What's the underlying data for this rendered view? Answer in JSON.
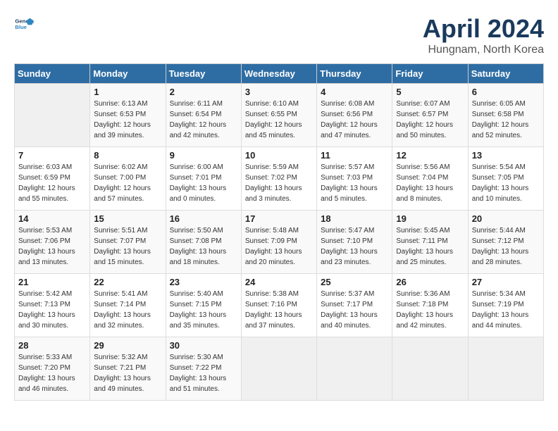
{
  "logo": {
    "text_general": "General",
    "text_blue": "Blue"
  },
  "title": "April 2024",
  "location": "Hungnam, North Korea",
  "days_header": [
    "Sunday",
    "Monday",
    "Tuesday",
    "Wednesday",
    "Thursday",
    "Friday",
    "Saturday"
  ],
  "weeks": [
    [
      {
        "num": "",
        "info": ""
      },
      {
        "num": "1",
        "info": "Sunrise: 6:13 AM\nSunset: 6:53 PM\nDaylight: 12 hours\nand 39 minutes."
      },
      {
        "num": "2",
        "info": "Sunrise: 6:11 AM\nSunset: 6:54 PM\nDaylight: 12 hours\nand 42 minutes."
      },
      {
        "num": "3",
        "info": "Sunrise: 6:10 AM\nSunset: 6:55 PM\nDaylight: 12 hours\nand 45 minutes."
      },
      {
        "num": "4",
        "info": "Sunrise: 6:08 AM\nSunset: 6:56 PM\nDaylight: 12 hours\nand 47 minutes."
      },
      {
        "num": "5",
        "info": "Sunrise: 6:07 AM\nSunset: 6:57 PM\nDaylight: 12 hours\nand 50 minutes."
      },
      {
        "num": "6",
        "info": "Sunrise: 6:05 AM\nSunset: 6:58 PM\nDaylight: 12 hours\nand 52 minutes."
      }
    ],
    [
      {
        "num": "7",
        "info": "Sunrise: 6:03 AM\nSunset: 6:59 PM\nDaylight: 12 hours\nand 55 minutes."
      },
      {
        "num": "8",
        "info": "Sunrise: 6:02 AM\nSunset: 7:00 PM\nDaylight: 12 hours\nand 57 minutes."
      },
      {
        "num": "9",
        "info": "Sunrise: 6:00 AM\nSunset: 7:01 PM\nDaylight: 13 hours\nand 0 minutes."
      },
      {
        "num": "10",
        "info": "Sunrise: 5:59 AM\nSunset: 7:02 PM\nDaylight: 13 hours\nand 3 minutes."
      },
      {
        "num": "11",
        "info": "Sunrise: 5:57 AM\nSunset: 7:03 PM\nDaylight: 13 hours\nand 5 minutes."
      },
      {
        "num": "12",
        "info": "Sunrise: 5:56 AM\nSunset: 7:04 PM\nDaylight: 13 hours\nand 8 minutes."
      },
      {
        "num": "13",
        "info": "Sunrise: 5:54 AM\nSunset: 7:05 PM\nDaylight: 13 hours\nand 10 minutes."
      }
    ],
    [
      {
        "num": "14",
        "info": "Sunrise: 5:53 AM\nSunset: 7:06 PM\nDaylight: 13 hours\nand 13 minutes."
      },
      {
        "num": "15",
        "info": "Sunrise: 5:51 AM\nSunset: 7:07 PM\nDaylight: 13 hours\nand 15 minutes."
      },
      {
        "num": "16",
        "info": "Sunrise: 5:50 AM\nSunset: 7:08 PM\nDaylight: 13 hours\nand 18 minutes."
      },
      {
        "num": "17",
        "info": "Sunrise: 5:48 AM\nSunset: 7:09 PM\nDaylight: 13 hours\nand 20 minutes."
      },
      {
        "num": "18",
        "info": "Sunrise: 5:47 AM\nSunset: 7:10 PM\nDaylight: 13 hours\nand 23 minutes."
      },
      {
        "num": "19",
        "info": "Sunrise: 5:45 AM\nSunset: 7:11 PM\nDaylight: 13 hours\nand 25 minutes."
      },
      {
        "num": "20",
        "info": "Sunrise: 5:44 AM\nSunset: 7:12 PM\nDaylight: 13 hours\nand 28 minutes."
      }
    ],
    [
      {
        "num": "21",
        "info": "Sunrise: 5:42 AM\nSunset: 7:13 PM\nDaylight: 13 hours\nand 30 minutes."
      },
      {
        "num": "22",
        "info": "Sunrise: 5:41 AM\nSunset: 7:14 PM\nDaylight: 13 hours\nand 32 minutes."
      },
      {
        "num": "23",
        "info": "Sunrise: 5:40 AM\nSunset: 7:15 PM\nDaylight: 13 hours\nand 35 minutes."
      },
      {
        "num": "24",
        "info": "Sunrise: 5:38 AM\nSunset: 7:16 PM\nDaylight: 13 hours\nand 37 minutes."
      },
      {
        "num": "25",
        "info": "Sunrise: 5:37 AM\nSunset: 7:17 PM\nDaylight: 13 hours\nand 40 minutes."
      },
      {
        "num": "26",
        "info": "Sunrise: 5:36 AM\nSunset: 7:18 PM\nDaylight: 13 hours\nand 42 minutes."
      },
      {
        "num": "27",
        "info": "Sunrise: 5:34 AM\nSunset: 7:19 PM\nDaylight: 13 hours\nand 44 minutes."
      }
    ],
    [
      {
        "num": "28",
        "info": "Sunrise: 5:33 AM\nSunset: 7:20 PM\nDaylight: 13 hours\nand 46 minutes."
      },
      {
        "num": "29",
        "info": "Sunrise: 5:32 AM\nSunset: 7:21 PM\nDaylight: 13 hours\nand 49 minutes."
      },
      {
        "num": "30",
        "info": "Sunrise: 5:30 AM\nSunset: 7:22 PM\nDaylight: 13 hours\nand 51 minutes."
      },
      {
        "num": "",
        "info": ""
      },
      {
        "num": "",
        "info": ""
      },
      {
        "num": "",
        "info": ""
      },
      {
        "num": "",
        "info": ""
      }
    ]
  ]
}
